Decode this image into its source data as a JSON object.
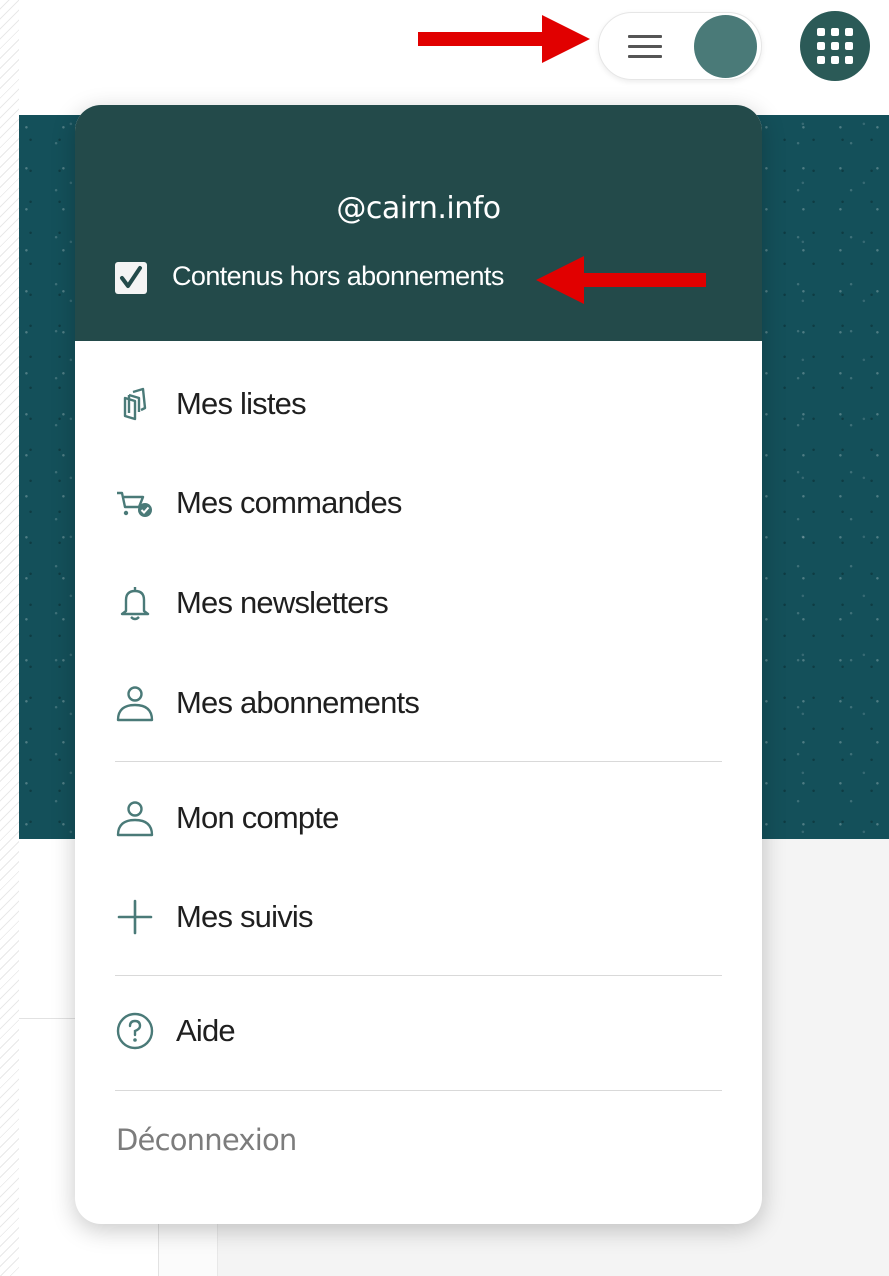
{
  "header": {
    "menu_icon": "hamburger-icon",
    "apps_icon": "apps-grid-icon",
    "accent_color": "#2b5a57"
  },
  "dropdown": {
    "user_handle": "@cairn.info",
    "checkbox": {
      "label": "Contenus hors abonnements",
      "checked": true
    },
    "items": [
      {
        "label": "Mes listes",
        "icon": "lists-icon"
      },
      {
        "label": "Mes commandes",
        "icon": "cart-check-icon"
      },
      {
        "label": "Mes newsletters",
        "icon": "bell-icon"
      },
      {
        "label": "Mes abonnements",
        "icon": "user-icon"
      },
      {
        "label": "Mon compte",
        "icon": "user-icon"
      },
      {
        "label": "Mes suivis",
        "icon": "plus-icon"
      },
      {
        "label": "Aide",
        "icon": "help-circle-icon"
      }
    ],
    "logout_label": "Déconnexion",
    "header_color": "#234a4a",
    "icon_color": "#4a7a78"
  },
  "annotations": {
    "arrow_color": "#e10000"
  }
}
